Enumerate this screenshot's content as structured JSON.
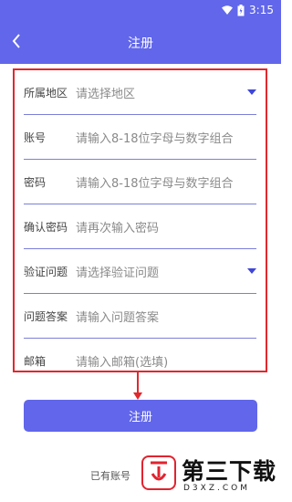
{
  "status_bar": {
    "time": "3:15",
    "battery_level": "charging"
  },
  "nav": {
    "title": "注册"
  },
  "form": {
    "rows": [
      {
        "label": "所属地区",
        "placeholder": "请选择地区",
        "has_dropdown": true
      },
      {
        "label": "账号",
        "placeholder": "请输入8-18位字母与数字组合",
        "has_dropdown": false
      },
      {
        "label": "密码",
        "placeholder": "请输入8-18位字母与数字组合",
        "has_dropdown": false
      },
      {
        "label": "确认密码",
        "placeholder": "请再次输入密码",
        "has_dropdown": false
      },
      {
        "label": "验证问题",
        "placeholder": "请选择验证问题",
        "has_dropdown": true
      },
      {
        "label": "问题答案",
        "placeholder": "请输入问题答案",
        "has_dropdown": false
      },
      {
        "label": "邮箱",
        "placeholder": "请输入邮箱(选填)",
        "has_dropdown": false
      }
    ]
  },
  "submit_label": "注册",
  "login_prompt": "已有账号",
  "watermark": {
    "name": "第三下载",
    "domain": "D3XZ.COM"
  },
  "colors": {
    "primary": "#6166ea",
    "highlight": "#e0282e",
    "divider": "#7b7fd7",
    "dropdown": "#3f46d8"
  }
}
